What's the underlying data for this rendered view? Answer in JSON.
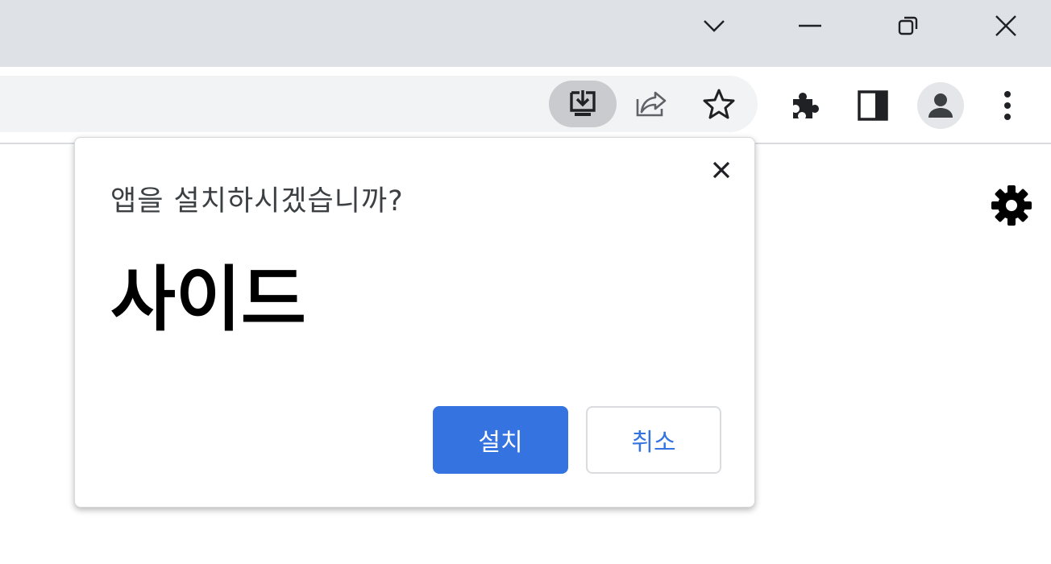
{
  "window_controls": {
    "tab_search_icon": "chevron-down-icon",
    "minimize_icon": "minimize-icon",
    "restore_icon": "restore-icon",
    "close_icon": "close-icon"
  },
  "toolbar": {
    "install_app_icon": "install-app-icon",
    "share_icon": "share-icon",
    "bookmark_icon": "star-icon",
    "extensions_icon": "puzzle-icon",
    "side_panel_icon": "side-panel-icon",
    "profile_icon": "person-icon",
    "menu_icon": "kebab-menu-icon"
  },
  "page": {
    "settings_icon": "gear-icon"
  },
  "install_dialog": {
    "title": "앱을 설치하시겠습니까?",
    "app_name": "사이드",
    "install_label": "설치",
    "cancel_label": "취소",
    "close_icon": "close-icon"
  },
  "colors": {
    "accent": "#3574e0",
    "titlebar": "#dee1e6",
    "omnibox": "#f1f3f4"
  }
}
